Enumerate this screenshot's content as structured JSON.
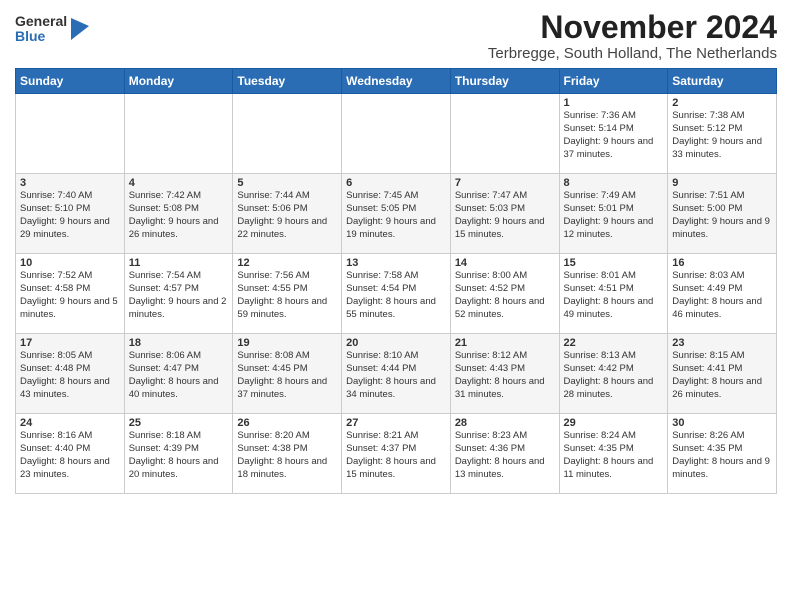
{
  "logo": {
    "general": "General",
    "blue": "Blue"
  },
  "title": "November 2024",
  "location": "Terbregge, South Holland, The Netherlands",
  "days_header": [
    "Sunday",
    "Monday",
    "Tuesday",
    "Wednesday",
    "Thursday",
    "Friday",
    "Saturday"
  ],
  "weeks": [
    [
      {
        "day": "",
        "info": ""
      },
      {
        "day": "",
        "info": ""
      },
      {
        "day": "",
        "info": ""
      },
      {
        "day": "",
        "info": ""
      },
      {
        "day": "",
        "info": ""
      },
      {
        "day": "1",
        "info": "Sunrise: 7:36 AM\nSunset: 5:14 PM\nDaylight: 9 hours and 37 minutes."
      },
      {
        "day": "2",
        "info": "Sunrise: 7:38 AM\nSunset: 5:12 PM\nDaylight: 9 hours and 33 minutes."
      }
    ],
    [
      {
        "day": "3",
        "info": "Sunrise: 7:40 AM\nSunset: 5:10 PM\nDaylight: 9 hours and 29 minutes."
      },
      {
        "day": "4",
        "info": "Sunrise: 7:42 AM\nSunset: 5:08 PM\nDaylight: 9 hours and 26 minutes."
      },
      {
        "day": "5",
        "info": "Sunrise: 7:44 AM\nSunset: 5:06 PM\nDaylight: 9 hours and 22 minutes."
      },
      {
        "day": "6",
        "info": "Sunrise: 7:45 AM\nSunset: 5:05 PM\nDaylight: 9 hours and 19 minutes."
      },
      {
        "day": "7",
        "info": "Sunrise: 7:47 AM\nSunset: 5:03 PM\nDaylight: 9 hours and 15 minutes."
      },
      {
        "day": "8",
        "info": "Sunrise: 7:49 AM\nSunset: 5:01 PM\nDaylight: 9 hours and 12 minutes."
      },
      {
        "day": "9",
        "info": "Sunrise: 7:51 AM\nSunset: 5:00 PM\nDaylight: 9 hours and 9 minutes."
      }
    ],
    [
      {
        "day": "10",
        "info": "Sunrise: 7:52 AM\nSunset: 4:58 PM\nDaylight: 9 hours and 5 minutes."
      },
      {
        "day": "11",
        "info": "Sunrise: 7:54 AM\nSunset: 4:57 PM\nDaylight: 9 hours and 2 minutes."
      },
      {
        "day": "12",
        "info": "Sunrise: 7:56 AM\nSunset: 4:55 PM\nDaylight: 8 hours and 59 minutes."
      },
      {
        "day": "13",
        "info": "Sunrise: 7:58 AM\nSunset: 4:54 PM\nDaylight: 8 hours and 55 minutes."
      },
      {
        "day": "14",
        "info": "Sunrise: 8:00 AM\nSunset: 4:52 PM\nDaylight: 8 hours and 52 minutes."
      },
      {
        "day": "15",
        "info": "Sunrise: 8:01 AM\nSunset: 4:51 PM\nDaylight: 8 hours and 49 minutes."
      },
      {
        "day": "16",
        "info": "Sunrise: 8:03 AM\nSunset: 4:49 PM\nDaylight: 8 hours and 46 minutes."
      }
    ],
    [
      {
        "day": "17",
        "info": "Sunrise: 8:05 AM\nSunset: 4:48 PM\nDaylight: 8 hours and 43 minutes."
      },
      {
        "day": "18",
        "info": "Sunrise: 8:06 AM\nSunset: 4:47 PM\nDaylight: 8 hours and 40 minutes."
      },
      {
        "day": "19",
        "info": "Sunrise: 8:08 AM\nSunset: 4:45 PM\nDaylight: 8 hours and 37 minutes."
      },
      {
        "day": "20",
        "info": "Sunrise: 8:10 AM\nSunset: 4:44 PM\nDaylight: 8 hours and 34 minutes."
      },
      {
        "day": "21",
        "info": "Sunrise: 8:12 AM\nSunset: 4:43 PM\nDaylight: 8 hours and 31 minutes."
      },
      {
        "day": "22",
        "info": "Sunrise: 8:13 AM\nSunset: 4:42 PM\nDaylight: 8 hours and 28 minutes."
      },
      {
        "day": "23",
        "info": "Sunrise: 8:15 AM\nSunset: 4:41 PM\nDaylight: 8 hours and 26 minutes."
      }
    ],
    [
      {
        "day": "24",
        "info": "Sunrise: 8:16 AM\nSunset: 4:40 PM\nDaylight: 8 hours and 23 minutes."
      },
      {
        "day": "25",
        "info": "Sunrise: 8:18 AM\nSunset: 4:39 PM\nDaylight: 8 hours and 20 minutes."
      },
      {
        "day": "26",
        "info": "Sunrise: 8:20 AM\nSunset: 4:38 PM\nDaylight: 8 hours and 18 minutes."
      },
      {
        "day": "27",
        "info": "Sunrise: 8:21 AM\nSunset: 4:37 PM\nDaylight: 8 hours and 15 minutes."
      },
      {
        "day": "28",
        "info": "Sunrise: 8:23 AM\nSunset: 4:36 PM\nDaylight: 8 hours and 13 minutes."
      },
      {
        "day": "29",
        "info": "Sunrise: 8:24 AM\nSunset: 4:35 PM\nDaylight: 8 hours and 11 minutes."
      },
      {
        "day": "30",
        "info": "Sunrise: 8:26 AM\nSunset: 4:35 PM\nDaylight: 8 hours and 9 minutes."
      }
    ]
  ]
}
